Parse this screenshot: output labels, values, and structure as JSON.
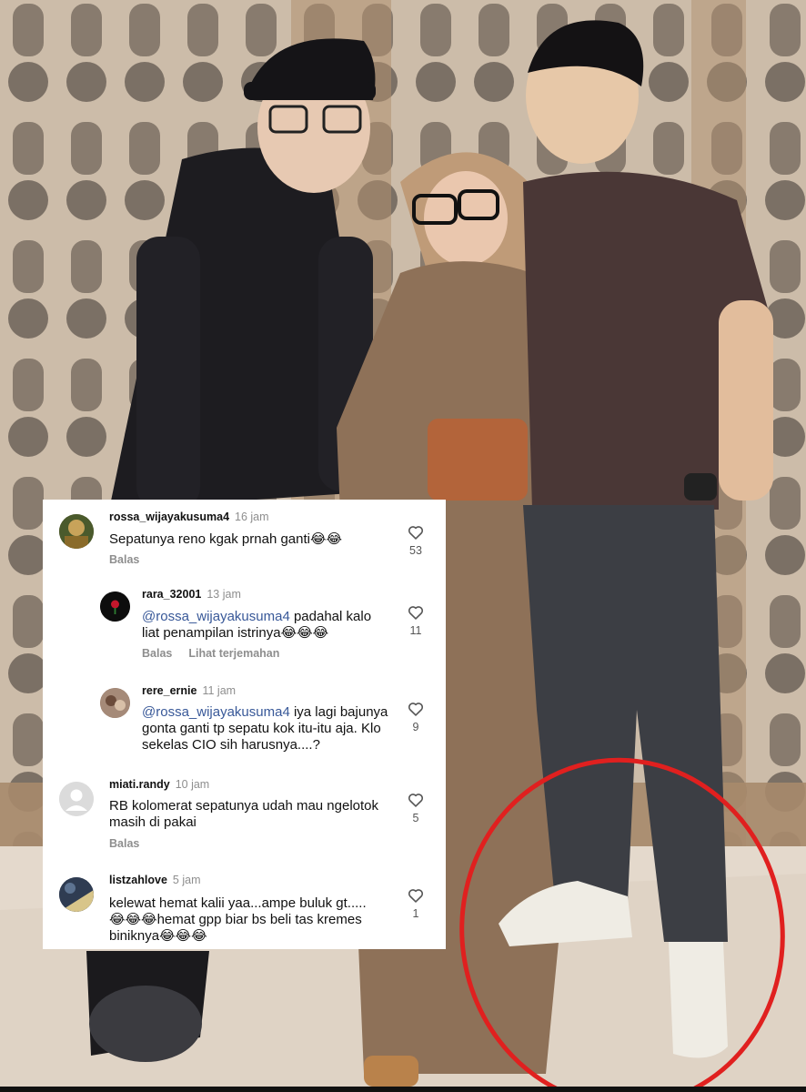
{
  "comments": [
    {
      "username": "rossa_wijayakusuma4",
      "time": "16 jam",
      "text": "Sepatunya reno kgak prnah ganti😂😂",
      "likes": "53",
      "reply_label": "Balas"
    },
    {
      "username": "rara_32001",
      "time": "13 jam",
      "mention": "@rossa_wijayakusuma4",
      "text": "padahal kalo liat penampilan istrinya😂😂😂",
      "likes": "11",
      "reply_label": "Balas",
      "translate_label": "Lihat terjemahan"
    },
    {
      "username": "rere_ernie",
      "time": "11 jam",
      "mention": "@rossa_wijayakusuma4",
      "text": "iya lagi bajunya gonta ganti tp sepatu kok itu-itu aja. Klo sekelas CIO sih harusnya....?",
      "likes": "9"
    },
    {
      "username": "miati.randy",
      "time": "10 jam",
      "text": "RB kolomerat sepatunya udah mau ngelotok masih di pakai",
      "likes": "5",
      "reply_label": "Balas"
    },
    {
      "username": "listzahlove",
      "time": "5 jam",
      "text": "kelewat hemat kalii yaa...ampe buluk gt.....😂😂😂hemat gpp biar bs beli tas kremes biniknya😂😂😂",
      "likes": "1"
    }
  ],
  "colors": {
    "highlight_circle": "#e0201f",
    "mention": "#385898",
    "muted": "#8e8e8e"
  }
}
